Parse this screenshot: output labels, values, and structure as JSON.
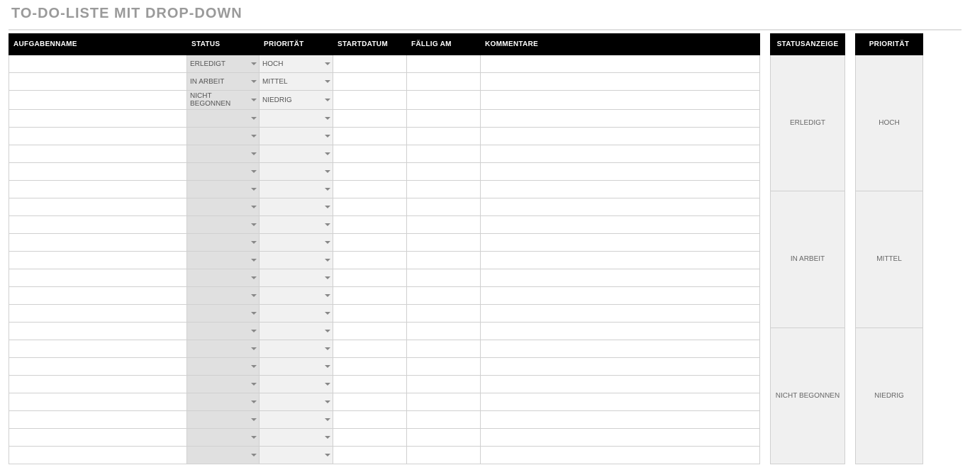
{
  "title": "TO-DO-LISTE MIT DROP-DOWN",
  "main": {
    "headers": {
      "name": "AUFGABENNAME",
      "status": "STATUS",
      "priority": "PRIORITÄT",
      "start": "STARTDATUM",
      "due": "FÄLLIG AM",
      "comments": "KOMMENTARE"
    },
    "rows": [
      {
        "name": "",
        "status": "ERLEDIGT",
        "priority": "HOCH",
        "start": "",
        "due": "",
        "comments": ""
      },
      {
        "name": "",
        "status": "IN ARBEIT",
        "priority": "MITTEL",
        "start": "",
        "due": "",
        "comments": ""
      },
      {
        "name": "",
        "status": "NICHT BEGONNEN",
        "priority": "NIEDRIG",
        "start": "",
        "due": "",
        "comments": ""
      },
      {
        "name": "",
        "status": "",
        "priority": "",
        "start": "",
        "due": "",
        "comments": ""
      },
      {
        "name": "",
        "status": "",
        "priority": "",
        "start": "",
        "due": "",
        "comments": ""
      },
      {
        "name": "",
        "status": "",
        "priority": "",
        "start": "",
        "due": "",
        "comments": ""
      },
      {
        "name": "",
        "status": "",
        "priority": "",
        "start": "",
        "due": "",
        "comments": ""
      },
      {
        "name": "",
        "status": "",
        "priority": "",
        "start": "",
        "due": "",
        "comments": ""
      },
      {
        "name": "",
        "status": "",
        "priority": "",
        "start": "",
        "due": "",
        "comments": ""
      },
      {
        "name": "",
        "status": "",
        "priority": "",
        "start": "",
        "due": "",
        "comments": ""
      },
      {
        "name": "",
        "status": "",
        "priority": "",
        "start": "",
        "due": "",
        "comments": ""
      },
      {
        "name": "",
        "status": "",
        "priority": "",
        "start": "",
        "due": "",
        "comments": ""
      },
      {
        "name": "",
        "status": "",
        "priority": "",
        "start": "",
        "due": "",
        "comments": ""
      },
      {
        "name": "",
        "status": "",
        "priority": "",
        "start": "",
        "due": "",
        "comments": ""
      },
      {
        "name": "",
        "status": "",
        "priority": "",
        "start": "",
        "due": "",
        "comments": ""
      },
      {
        "name": "",
        "status": "",
        "priority": "",
        "start": "",
        "due": "",
        "comments": ""
      },
      {
        "name": "",
        "status": "",
        "priority": "",
        "start": "",
        "due": "",
        "comments": ""
      },
      {
        "name": "",
        "status": "",
        "priority": "",
        "start": "",
        "due": "",
        "comments": ""
      },
      {
        "name": "",
        "status": "",
        "priority": "",
        "start": "",
        "due": "",
        "comments": ""
      },
      {
        "name": "",
        "status": "",
        "priority": "",
        "start": "",
        "due": "",
        "comments": ""
      },
      {
        "name": "",
        "status": "",
        "priority": "",
        "start": "",
        "due": "",
        "comments": ""
      },
      {
        "name": "",
        "status": "",
        "priority": "",
        "start": "",
        "due": "",
        "comments": ""
      },
      {
        "name": "",
        "status": "",
        "priority": "",
        "start": "",
        "due": "",
        "comments": ""
      }
    ]
  },
  "legend_status": {
    "header": "STATUSANZEIGE",
    "items": [
      "ERLEDIGT",
      "IN ARBEIT",
      "NICHT BEGONNEN"
    ]
  },
  "legend_priority": {
    "header": "PRIORITÄT",
    "items": [
      "HOCH",
      "MITTEL",
      "NIEDRIG"
    ]
  }
}
